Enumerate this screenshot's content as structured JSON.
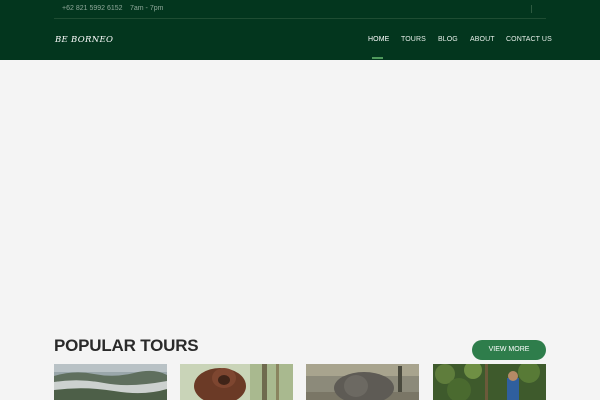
{
  "topbar": {
    "phone": "+62 821 5992 6152",
    "hours": "7am - 7pm"
  },
  "brand": {
    "name": "BE BORNEO"
  },
  "nav": {
    "items": [
      {
        "label": "HOME",
        "active": true
      },
      {
        "label": "TOURS",
        "active": false
      },
      {
        "label": "BLOG",
        "active": false
      },
      {
        "label": "ABOUT",
        "active": false
      },
      {
        "label": "CONTACT US",
        "active": false
      }
    ]
  },
  "popular_tours": {
    "title": "POPULAR TOURS",
    "view_more_label": "VIEW MORE",
    "cards": [
      {
        "image": "misty-mountain-forest"
      },
      {
        "image": "orangutan"
      },
      {
        "image": "elephant"
      },
      {
        "image": "jungle-trekker"
      }
    ]
  },
  "colors": {
    "header_bg": "#03361e",
    "accent_green": "#2e7d4b",
    "page_bg": "#f4f4f4"
  }
}
